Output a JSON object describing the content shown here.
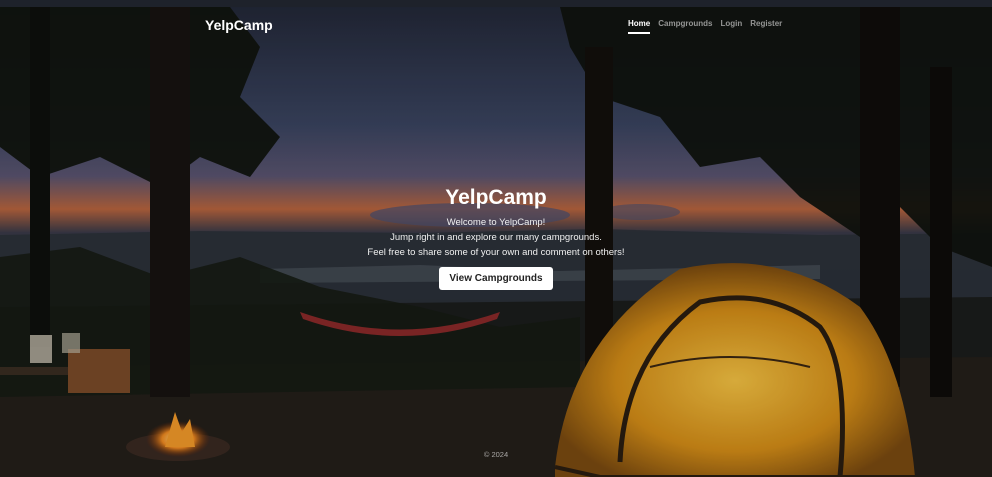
{
  "navbar": {
    "brand": "YelpCamp",
    "links": [
      {
        "label": "Home",
        "active": true
      },
      {
        "label": "Campgrounds",
        "active": false
      },
      {
        "label": "Login",
        "active": false
      },
      {
        "label": "Register",
        "active": false
      }
    ]
  },
  "hero": {
    "title": "YelpCamp",
    "lines": [
      "Welcome to YelpCamp!",
      "Jump right in and explore our many campgrounds.",
      "Feel free to share some of your own and comment on others!"
    ],
    "button_label": "View Campgrounds"
  },
  "footer": {
    "text": "© 2024"
  },
  "colors": {
    "sky_top": "#2c3448",
    "sunset": "#c96a3c",
    "tent": "#e0a21f",
    "nav_active": "#ffffff"
  }
}
